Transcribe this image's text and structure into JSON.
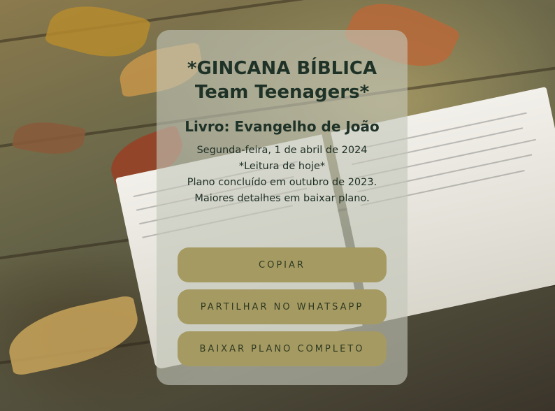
{
  "card": {
    "title_line1": "*GINCANA BÍBLICA",
    "title_line2": "Team Teenagers*",
    "book": "Livro: Evangelho de João",
    "date": "Segunda-feira, 1 de abril de 2024",
    "reading_label": "*Leitura de hoje*",
    "plan_status": "Plano concluído em outubro de 2023.",
    "details": "Maiores detalhes em baixar plano."
  },
  "buttons": {
    "copy": "COPIAR",
    "share_whatsapp": "PARTILHAR NO WHATSAPP",
    "download_plan": "BAIXAR PLANO COMPLETO"
  },
  "colors": {
    "card_background": "#c3c7b9",
    "text": "#1e3227",
    "button": "#a59a62",
    "button_text": "#2f3a22"
  }
}
